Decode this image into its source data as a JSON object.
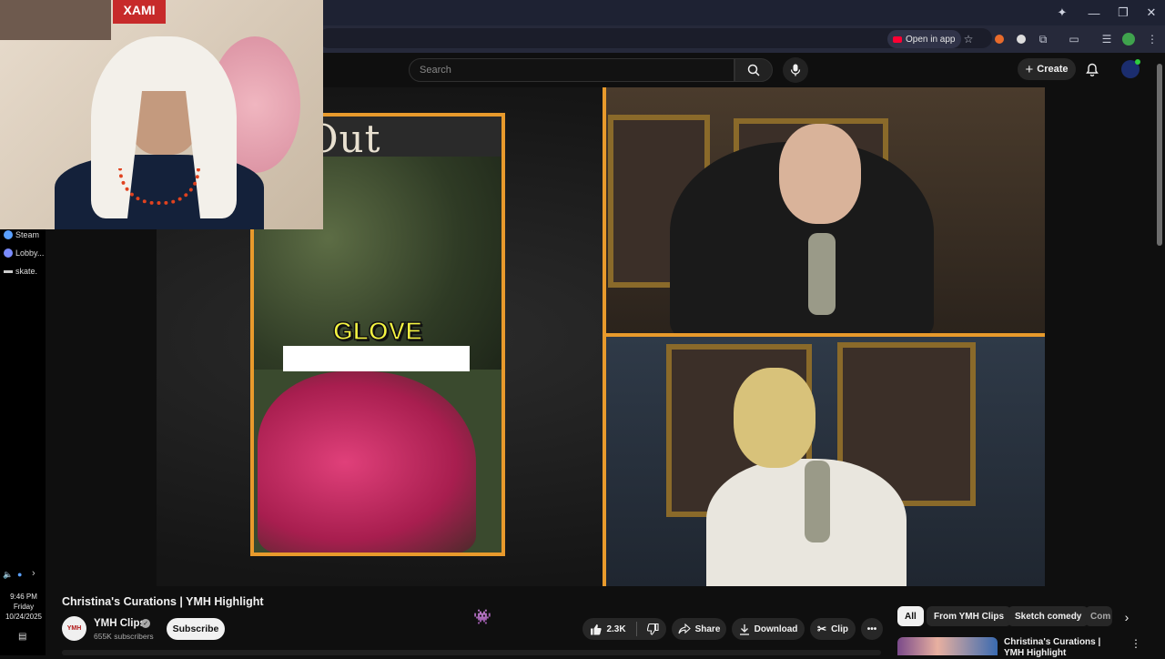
{
  "browser": {
    "open_in_app_label": "Open in app",
    "window_controls": [
      "minimize-icon",
      "restore-icon",
      "close-icon"
    ]
  },
  "header": {
    "search_placeholder": "Search",
    "create_label": "Create"
  },
  "video_overlay": {
    "title_text_fragment": "et Out",
    "caption_word": "GLOVE"
  },
  "webcam": {
    "sign_text": "XAMI"
  },
  "taskbar": {
    "items": [
      {
        "label": "Steam",
        "color": "#5aa0ff"
      },
      {
        "label": "Lobby...",
        "color": "#7b8cff"
      },
      {
        "label": "skate.",
        "color": "#cccccc"
      }
    ],
    "clock": {
      "time": "9:46 PM",
      "day": "Friday",
      "date": "10/24/2025"
    }
  },
  "video": {
    "title": "Christina's Curations | YMH Highlight",
    "channel": {
      "name": "YMH Clips",
      "avatar_text": "YMH",
      "subscribers": "655K subscribers",
      "subscribe_label": "Subscribe"
    },
    "actions": {
      "likes": "2.3K",
      "share_label": "Share",
      "download_label": "Download",
      "clip_label": "Clip"
    }
  },
  "chips": [
    "All",
    "From YMH Clips",
    "Sketch comedy",
    "Com"
  ],
  "recommended": {
    "title": "Christina's Curations | YMH Highlight"
  },
  "colors": {
    "accent_orange": "#e89a2c",
    "youtube_red": "#ff0033",
    "bg": "#0f0f0f"
  }
}
